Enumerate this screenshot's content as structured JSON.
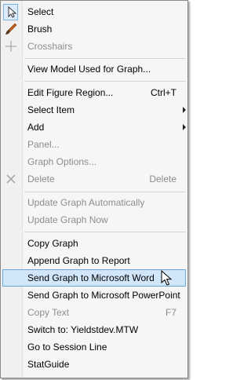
{
  "menu": {
    "items": [
      {
        "label": "Select",
        "enabled": true,
        "icon": "pointer-icon",
        "checked": true
      },
      {
        "label": "Brush",
        "enabled": true,
        "icon": "brush-icon"
      },
      {
        "label": "Crosshairs",
        "enabled": false,
        "icon": "crosshairs-icon"
      },
      {
        "label": "View Model Used for Graph...",
        "enabled": true
      },
      {
        "label": "Edit Figure Region...",
        "enabled": true,
        "shortcut": "Ctrl+T"
      },
      {
        "label": "Select Item",
        "enabled": true,
        "submenu": true
      },
      {
        "label": "Add",
        "enabled": true,
        "submenu": true
      },
      {
        "label": "Panel...",
        "enabled": false
      },
      {
        "label": "Graph Options...",
        "enabled": false
      },
      {
        "label": "Delete",
        "enabled": false,
        "shortcut": "Delete",
        "icon": "delete-x-icon"
      },
      {
        "label": "Update Graph Automatically",
        "enabled": false
      },
      {
        "label": "Update Graph Now",
        "enabled": false
      },
      {
        "label": "Copy Graph",
        "enabled": true
      },
      {
        "label": "Append Graph to Report",
        "enabled": true
      },
      {
        "label": "Send Graph to Microsoft Word",
        "enabled": true,
        "highlighted": true
      },
      {
        "label": "Send Graph to Microsoft PowerPoint",
        "enabled": true
      },
      {
        "label": "Copy Text",
        "enabled": false,
        "shortcut": "F7"
      },
      {
        "label": "Switch to: Yieldstdev.MTW",
        "enabled": true
      },
      {
        "label": "Go to Session Line",
        "enabled": true
      },
      {
        "label": "StatGuide",
        "enabled": true
      }
    ]
  },
  "colors": {
    "menu_bg": "#f6f6f6",
    "highlight": "#d2e6fa",
    "highlight_border": "#6fa5df",
    "disabled_text": "#8d8d8d"
  }
}
